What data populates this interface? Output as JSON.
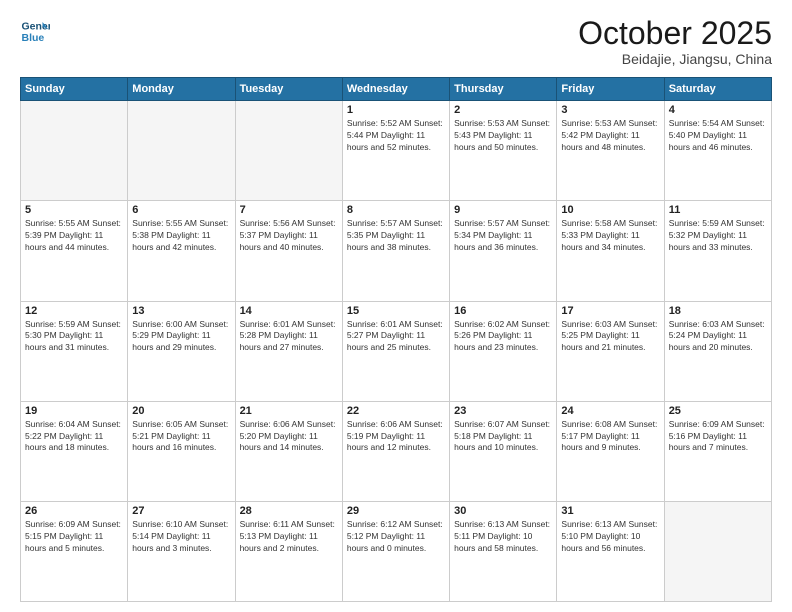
{
  "header": {
    "logo_line1": "General",
    "logo_line2": "Blue",
    "month": "October 2025",
    "location": "Beidajie, Jiangsu, China"
  },
  "weekdays": [
    "Sunday",
    "Monday",
    "Tuesday",
    "Wednesday",
    "Thursday",
    "Friday",
    "Saturday"
  ],
  "weeks": [
    [
      {
        "day": "",
        "info": ""
      },
      {
        "day": "",
        "info": ""
      },
      {
        "day": "",
        "info": ""
      },
      {
        "day": "1",
        "info": "Sunrise: 5:52 AM\nSunset: 5:44 PM\nDaylight: 11 hours\nand 52 minutes."
      },
      {
        "day": "2",
        "info": "Sunrise: 5:53 AM\nSunset: 5:43 PM\nDaylight: 11 hours\nand 50 minutes."
      },
      {
        "day": "3",
        "info": "Sunrise: 5:53 AM\nSunset: 5:42 PM\nDaylight: 11 hours\nand 48 minutes."
      },
      {
        "day": "4",
        "info": "Sunrise: 5:54 AM\nSunset: 5:40 PM\nDaylight: 11 hours\nand 46 minutes."
      }
    ],
    [
      {
        "day": "5",
        "info": "Sunrise: 5:55 AM\nSunset: 5:39 PM\nDaylight: 11 hours\nand 44 minutes."
      },
      {
        "day": "6",
        "info": "Sunrise: 5:55 AM\nSunset: 5:38 PM\nDaylight: 11 hours\nand 42 minutes."
      },
      {
        "day": "7",
        "info": "Sunrise: 5:56 AM\nSunset: 5:37 PM\nDaylight: 11 hours\nand 40 minutes."
      },
      {
        "day": "8",
        "info": "Sunrise: 5:57 AM\nSunset: 5:35 PM\nDaylight: 11 hours\nand 38 minutes."
      },
      {
        "day": "9",
        "info": "Sunrise: 5:57 AM\nSunset: 5:34 PM\nDaylight: 11 hours\nand 36 minutes."
      },
      {
        "day": "10",
        "info": "Sunrise: 5:58 AM\nSunset: 5:33 PM\nDaylight: 11 hours\nand 34 minutes."
      },
      {
        "day": "11",
        "info": "Sunrise: 5:59 AM\nSunset: 5:32 PM\nDaylight: 11 hours\nand 33 minutes."
      }
    ],
    [
      {
        "day": "12",
        "info": "Sunrise: 5:59 AM\nSunset: 5:30 PM\nDaylight: 11 hours\nand 31 minutes."
      },
      {
        "day": "13",
        "info": "Sunrise: 6:00 AM\nSunset: 5:29 PM\nDaylight: 11 hours\nand 29 minutes."
      },
      {
        "day": "14",
        "info": "Sunrise: 6:01 AM\nSunset: 5:28 PM\nDaylight: 11 hours\nand 27 minutes."
      },
      {
        "day": "15",
        "info": "Sunrise: 6:01 AM\nSunset: 5:27 PM\nDaylight: 11 hours\nand 25 minutes."
      },
      {
        "day": "16",
        "info": "Sunrise: 6:02 AM\nSunset: 5:26 PM\nDaylight: 11 hours\nand 23 minutes."
      },
      {
        "day": "17",
        "info": "Sunrise: 6:03 AM\nSunset: 5:25 PM\nDaylight: 11 hours\nand 21 minutes."
      },
      {
        "day": "18",
        "info": "Sunrise: 6:03 AM\nSunset: 5:24 PM\nDaylight: 11 hours\nand 20 minutes."
      }
    ],
    [
      {
        "day": "19",
        "info": "Sunrise: 6:04 AM\nSunset: 5:22 PM\nDaylight: 11 hours\nand 18 minutes."
      },
      {
        "day": "20",
        "info": "Sunrise: 6:05 AM\nSunset: 5:21 PM\nDaylight: 11 hours\nand 16 minutes."
      },
      {
        "day": "21",
        "info": "Sunrise: 6:06 AM\nSunset: 5:20 PM\nDaylight: 11 hours\nand 14 minutes."
      },
      {
        "day": "22",
        "info": "Sunrise: 6:06 AM\nSunset: 5:19 PM\nDaylight: 11 hours\nand 12 minutes."
      },
      {
        "day": "23",
        "info": "Sunrise: 6:07 AM\nSunset: 5:18 PM\nDaylight: 11 hours\nand 10 minutes."
      },
      {
        "day": "24",
        "info": "Sunrise: 6:08 AM\nSunset: 5:17 PM\nDaylight: 11 hours\nand 9 minutes."
      },
      {
        "day": "25",
        "info": "Sunrise: 6:09 AM\nSunset: 5:16 PM\nDaylight: 11 hours\nand 7 minutes."
      }
    ],
    [
      {
        "day": "26",
        "info": "Sunrise: 6:09 AM\nSunset: 5:15 PM\nDaylight: 11 hours\nand 5 minutes."
      },
      {
        "day": "27",
        "info": "Sunrise: 6:10 AM\nSunset: 5:14 PM\nDaylight: 11 hours\nand 3 minutes."
      },
      {
        "day": "28",
        "info": "Sunrise: 6:11 AM\nSunset: 5:13 PM\nDaylight: 11 hours\nand 2 minutes."
      },
      {
        "day": "29",
        "info": "Sunrise: 6:12 AM\nSunset: 5:12 PM\nDaylight: 11 hours\nand 0 minutes."
      },
      {
        "day": "30",
        "info": "Sunrise: 6:13 AM\nSunset: 5:11 PM\nDaylight: 10 hours\nand 58 minutes."
      },
      {
        "day": "31",
        "info": "Sunrise: 6:13 AM\nSunset: 5:10 PM\nDaylight: 10 hours\nand 56 minutes."
      },
      {
        "day": "",
        "info": ""
      }
    ]
  ]
}
